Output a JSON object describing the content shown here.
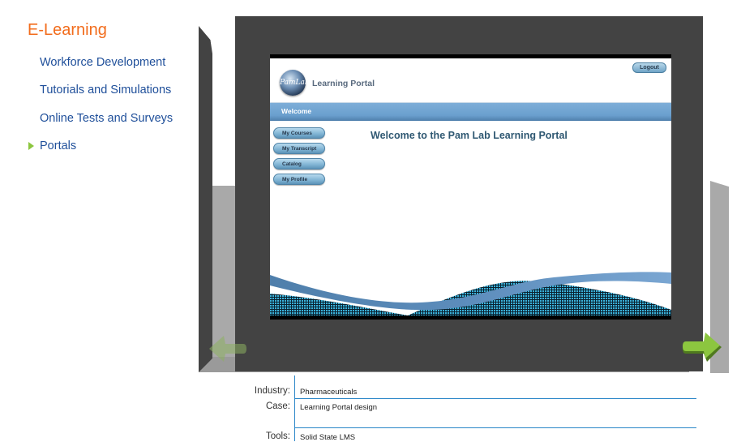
{
  "nav": {
    "title": "E-Learning",
    "items": [
      {
        "label": "Workforce Development",
        "active": false
      },
      {
        "label": "Tutorials and Simulations",
        "active": false
      },
      {
        "label": "Online Tests and Surveys",
        "active": false
      },
      {
        "label": "Portals",
        "active": true
      }
    ],
    "active_bullet_color": "#8cc63f",
    "title_color": "#f26c1c",
    "link_color": "#1f4f9a"
  },
  "gallery": {
    "prev_arrow": {
      "icon": "arrow-left-icon",
      "enabled": false
    },
    "next_arrow": {
      "icon": "arrow-right-icon",
      "enabled": true
    },
    "arrow_color": "#8cc63f",
    "screenshot": {
      "logout_label": "Logout",
      "logo_text": "PamLab",
      "portal_title": "Learning Portal",
      "welcome_bar_label": "Welcome",
      "side_menu": [
        "My Courses",
        "My Transcript",
        "Catalog",
        "My Profile"
      ],
      "heading": "Welcome to the Pam Lab Learning Portal"
    }
  },
  "info": {
    "rows": [
      {
        "label": "Industry:",
        "value": "Pharmaceuticals"
      },
      {
        "label": "Case:",
        "value": "Learning Portal design"
      },
      {
        "label": "Tools:",
        "value": "Solid State LMS"
      }
    ],
    "rule_color": "#2a86c8"
  }
}
